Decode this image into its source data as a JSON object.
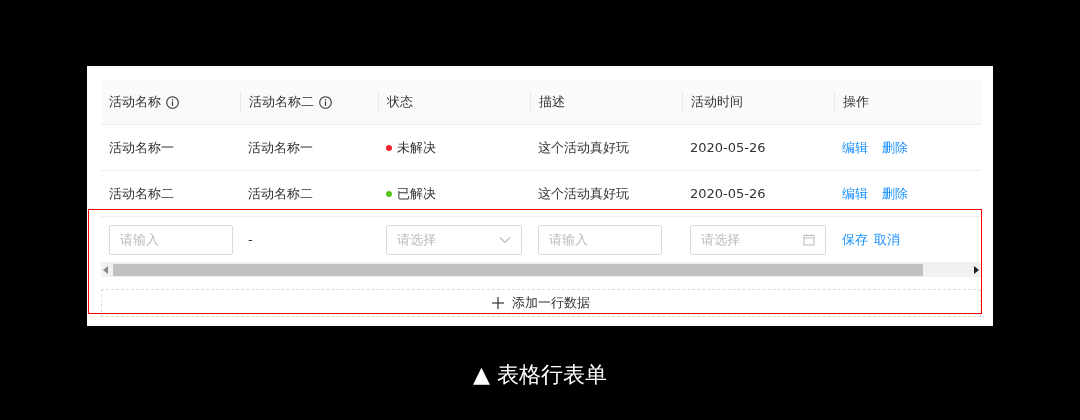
{
  "table": {
    "columns": [
      {
        "label": "活动名称",
        "info": true
      },
      {
        "label": "活动名称二",
        "info": true
      },
      {
        "label": "状态",
        "info": false
      },
      {
        "label": "描述",
        "info": false
      },
      {
        "label": "活动时间",
        "info": false
      },
      {
        "label": "操作",
        "info": false
      }
    ],
    "rows": [
      {
        "name": "活动名称一",
        "name2": "活动名称一",
        "status": {
          "label": "未解决",
          "color": "#f5222d"
        },
        "description": "这个活动真好玩",
        "date": "2020-05-26",
        "actions": [
          "编辑",
          "删除"
        ]
      },
      {
        "name": "活动名称二",
        "name2": "活动名称二",
        "status": {
          "label": "已解决",
          "color": "#52c41a"
        },
        "description": "这个活动真好玩",
        "date": "2020-05-26",
        "actions": [
          "编辑",
          "删除"
        ]
      }
    ],
    "edit_row": {
      "cells": [
        {
          "kind": "input",
          "placeholder": "请输入"
        },
        {
          "kind": "text",
          "value": "-"
        },
        {
          "kind": "select",
          "placeholder": "请选择"
        },
        {
          "kind": "input",
          "placeholder": "请输入"
        },
        {
          "kind": "date",
          "placeholder": "请选择"
        },
        {
          "kind": "actions",
          "links": [
            "保存",
            "取消"
          ]
        }
      ]
    },
    "add_button": "添加一行数据"
  },
  "caption": "▲ 表格行表单"
}
